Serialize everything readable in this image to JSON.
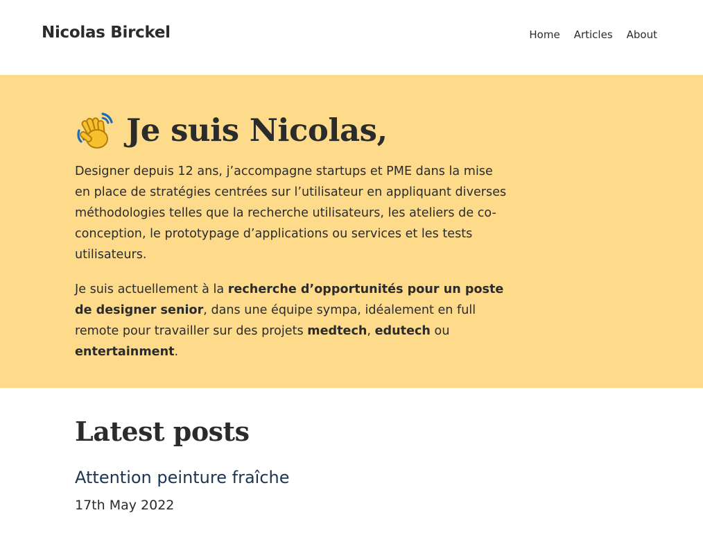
{
  "header": {
    "site_title": "Nicolas Birckel",
    "nav": [
      {
        "label": "Home"
      },
      {
        "label": "Articles"
      },
      {
        "label": "About"
      }
    ]
  },
  "hero": {
    "icon": "waving-hand-icon",
    "heading": "Je suis Nicolas,",
    "bio": "Designer depuis 12 ans, j’accompagne startups et PME dans la mise en place de stratégies centrées sur l’utilisateur en appliquant diverses méthodologies telles que la recherche utilisateurs, les ateliers de co-conception, le prototypage d’applications ou services et les tests utilisateurs.",
    "availability": {
      "t1": "Je suis actuellement à la ",
      "b1": "recherche d’opportunités pour un poste de designer senior",
      "t2": ", dans une équipe sympa, idéalement en full remote pour travailler sur des projets ",
      "b2": "medtech",
      "t3": ", ",
      "b3": "edutech",
      "t4": " ou ",
      "b4": "entertainment",
      "t5": "."
    }
  },
  "latest_posts": {
    "heading": "Latest posts",
    "items": [
      {
        "title": "Attention peinture fraîche",
        "date": "17th May 2022"
      }
    ]
  },
  "colors": {
    "hero_background": "#fddb8b",
    "text": "#2b2b2b",
    "post_link": "#1b3552",
    "background": "#ffffff"
  }
}
